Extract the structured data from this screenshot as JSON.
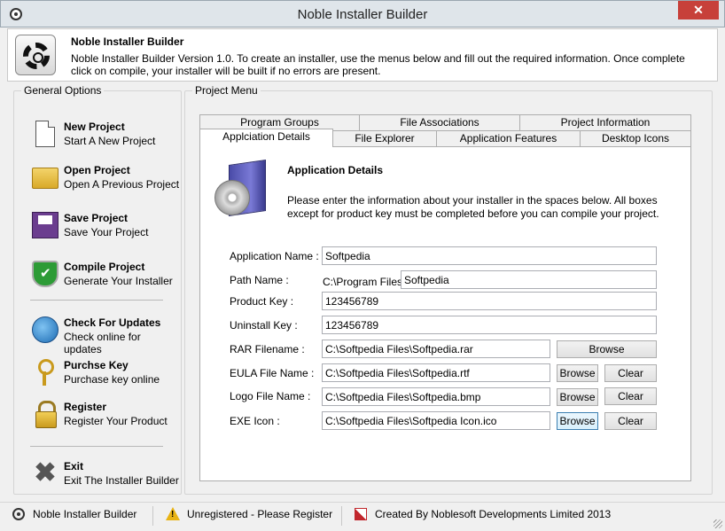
{
  "window": {
    "title": "Noble Installer Builder",
    "close_label": "✕"
  },
  "header": {
    "title": "Noble Installer Builder",
    "description": "Noble Installer Builder Version 1.0. To create an installer, use the menus below and fill out the required information. Once complete click on compile, your installer will be built if no errors are present."
  },
  "general_options": {
    "title": "General Options",
    "items": [
      {
        "title": "New Project",
        "subtitle": "Start A New Project",
        "icon": "new-document-icon"
      },
      {
        "title": "Open Project",
        "subtitle": "Open A Previous Project",
        "icon": "folder-icon"
      },
      {
        "title": "Save Project",
        "subtitle": "Save Your Project",
        "icon": "floppy-disk-icon"
      },
      {
        "title": "Compile Project",
        "subtitle": "Generate Your Installer",
        "icon": "shield-check-icon"
      },
      {
        "title": "Check For Updates",
        "subtitle": "Check online for updates",
        "icon": "globe-icon"
      },
      {
        "title": "Purchse Key",
        "subtitle": "Purchase key online",
        "icon": "key-icon"
      },
      {
        "title": "Register",
        "subtitle": "Register Your Product",
        "icon": "padlock-icon"
      },
      {
        "title": "Exit",
        "subtitle": "Exit The Installer Builder",
        "icon": "close-x-icon"
      }
    ]
  },
  "project_menu": {
    "title": "Project Menu",
    "tabs_row1": [
      "Program Groups",
      "File Associations",
      "Project Information"
    ],
    "tabs_row2": [
      "Applciation Details",
      "File Explorer",
      "Application Features",
      "Desktop Icons"
    ],
    "active_tab": "Applciation Details"
  },
  "app_details": {
    "title": "Application Details",
    "description": "Please enter the information about your installer in the spaces below. All boxes except for product key must be completed before you can compile your project.",
    "fields": {
      "app_name_label": "Application Name :",
      "app_name_value": "Softpedia",
      "path_label": "Path Name :",
      "path_prefix": "C:\\Program Files\\",
      "path_value": "Softpedia",
      "product_key_label": "Product Key :",
      "product_key_value": "123456789",
      "uninstall_key_label": "Uninstall Key :",
      "uninstall_key_value": "123456789",
      "rar_label": "RAR Filename :",
      "rar_value": "C:\\Softpedia Files\\Softpedia.rar",
      "eula_label": "EULA File Name :",
      "eula_value": "C:\\Softpedia Files\\Softpedia.rtf",
      "logo_label": "Logo File Name :",
      "logo_value": "C:\\Softpedia Files\\Softpedia.bmp",
      "exe_label": "EXE Icon :",
      "exe_value": "C:\\Softpedia Files\\Softpedia Icon.ico"
    },
    "browse_label": "Browse",
    "clear_label": "Clear"
  },
  "statusbar": {
    "app_name": "Noble Installer Builder",
    "registration": "Unregistered - Please Register",
    "credits": "Created By Noblesoft Developments Limited 2013"
  }
}
